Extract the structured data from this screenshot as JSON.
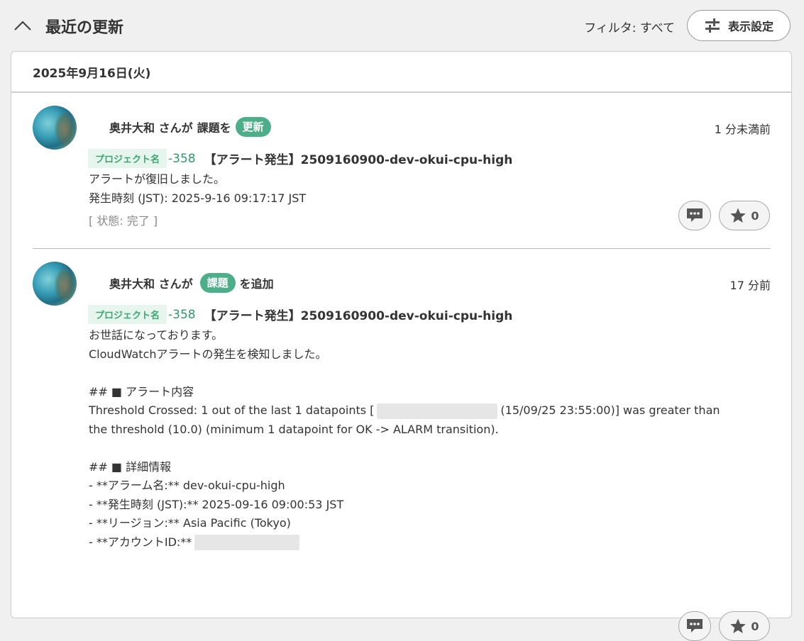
{
  "header": {
    "title": "最近の更新",
    "filter_text": "フィルタ: すべて",
    "settings_label": "表示設定"
  },
  "date_label": "2025年9月16日(火)",
  "entries": [
    {
      "actor": "奥井大和 さんが",
      "action_prefix": "課題を",
      "action_badge": "更新",
      "action_suffix": "",
      "time": "1 分未満前",
      "project_tag": "プロジェクト名",
      "issue_key": "-358",
      "issue_title": "【アラート発生】2509160900-dev-okui-cpu-high",
      "lines": [
        "アラートが復旧しました。",
        "発生時刻 (JST): 2025-9-16 09:17:17 JST"
      ],
      "status": "[ 状態: 完了 ]",
      "star_count": "0"
    },
    {
      "actor": "奥井大和 さんが",
      "action_prefix": "",
      "action_badge": "課題",
      "action_suffix": "を追加",
      "time": "17 分前",
      "project_tag": "プロジェクト名",
      "issue_key": "-358",
      "issue_title": "【アラート発生】2509160900-dev-okui-cpu-high",
      "lines": [
        "お世話になっております。",
        "CloudWatchアラートの発生を検知しました。",
        "",
        "## ■ アラート内容",
        "Threshold Crossed: 1 out of the last 1 datapoints [",
        "(15/09/25 23:55:00)] was greater than",
        "the threshold (10.0) (minimum 1 datapoint for OK -> ALARM transition).",
        "",
        "## ■ 詳細情報",
        "- **アラーム名:** dev-okui-cpu-high",
        "- **発生時刻 (JST):** 2025-09-16 09:00:53 JST",
        "- **リージョン:** Asia Pacific (Tokyo)",
        "- **アカウントID:**"
      ],
      "star_count": "0"
    }
  ]
}
